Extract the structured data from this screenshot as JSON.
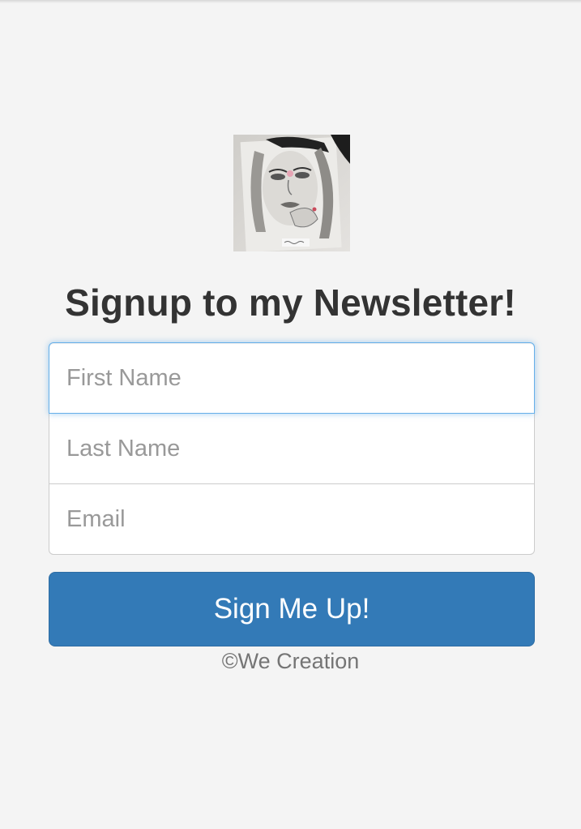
{
  "header": {
    "logo_alt": "Drawing of a girl"
  },
  "main": {
    "title": "Signup to my Newsletter!",
    "form": {
      "first_name_placeholder": "First Name",
      "last_name_placeholder": "Last Name",
      "email_placeholder": "Email",
      "submit_label": "Sign Me Up!"
    }
  },
  "footer": {
    "copyright": "©We Creation"
  },
  "colors": {
    "background": "#f4f4f4",
    "button": "#337ab7",
    "focus_border": "#66afe9",
    "title_text": "#333333"
  }
}
